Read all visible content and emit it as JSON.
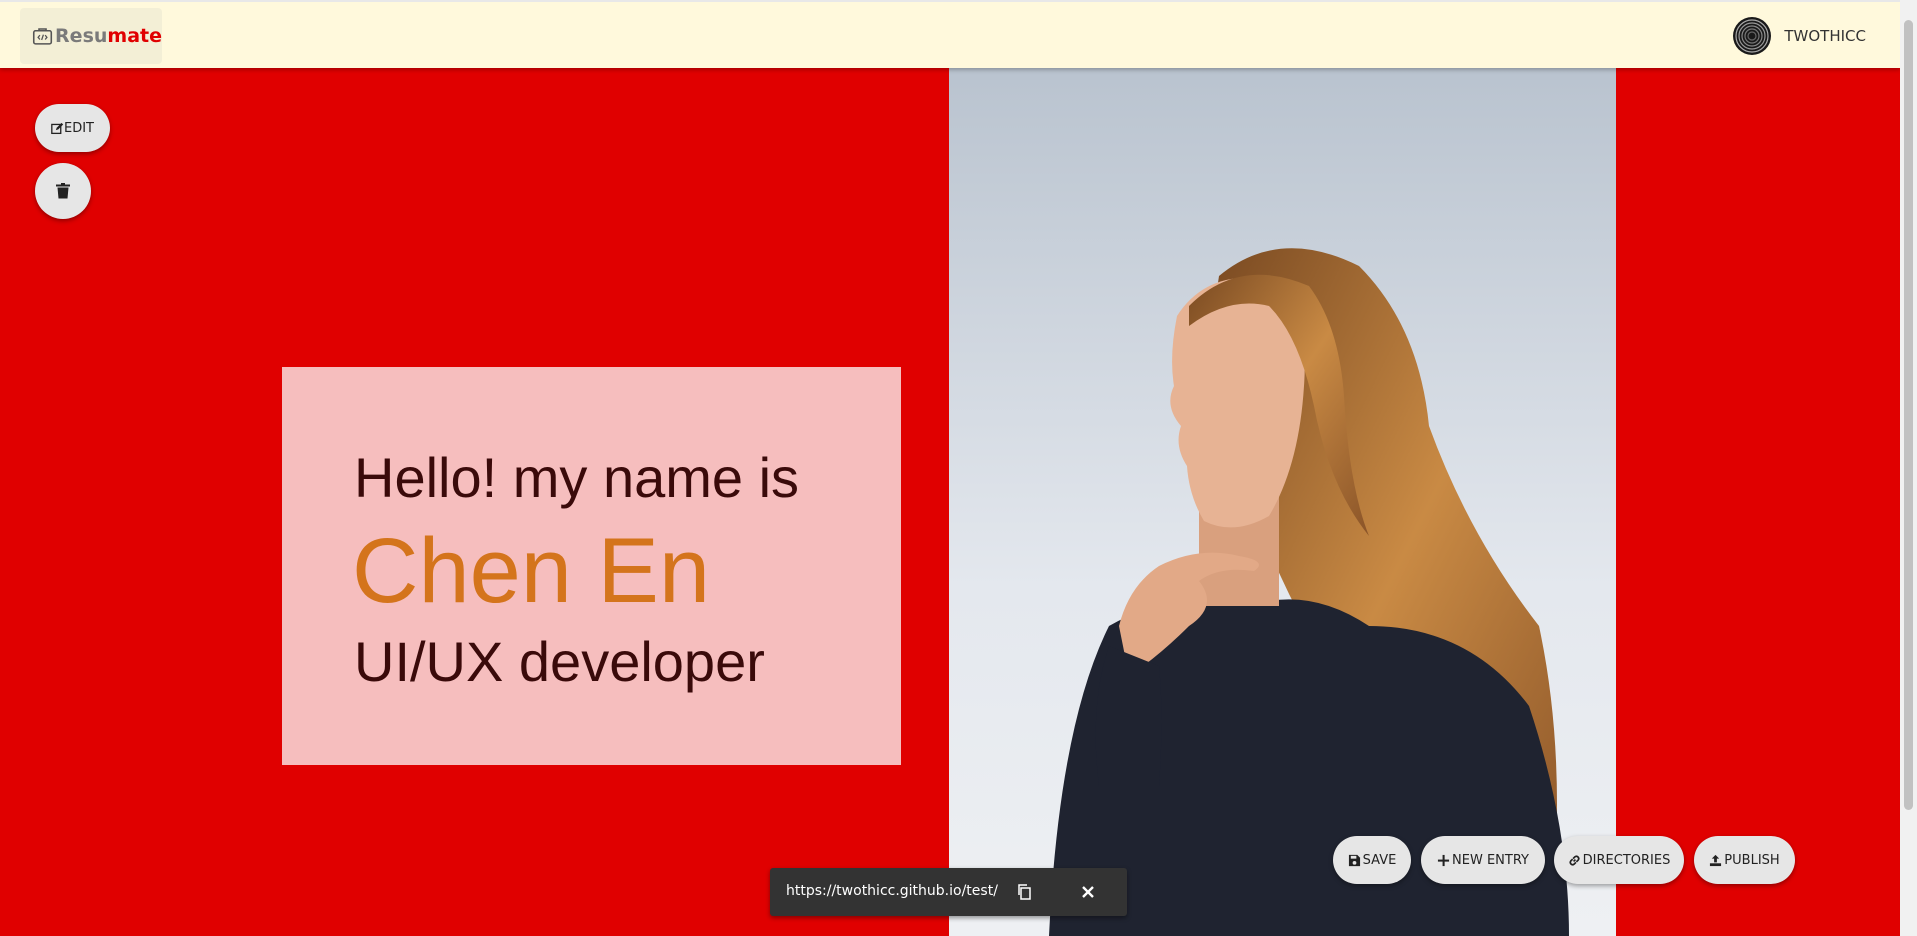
{
  "app": {
    "brand_part1": "Resu",
    "brand_part2": "mate",
    "username": "TWOTHICC"
  },
  "sidebar_actions": {
    "edit_label": "EDIT"
  },
  "hero": {
    "greeting": "Hello! my name is",
    "name": "Chen En",
    "role": "UI/UX developer"
  },
  "actions": {
    "save_label": "SAVE",
    "new_entry_label": "NEW ENTRY",
    "directories_label": "DIRECTORIES",
    "publish_label": "PUBLISH"
  },
  "toast": {
    "url": "https://twothicc.github.io/test/"
  },
  "colors": {
    "page_background": "#e00000",
    "topbar": "#fff9dc",
    "card": "#f6bebe",
    "name_accent": "#d4741c",
    "text_dark": "#3a0a0a"
  },
  "icons": [
    "code-briefcase-icon",
    "avatar-spiral-icon",
    "edit-icon",
    "trash-icon",
    "save-icon",
    "plus-icon",
    "link-icon",
    "upload-icon",
    "copy-icon",
    "close-icon"
  ]
}
